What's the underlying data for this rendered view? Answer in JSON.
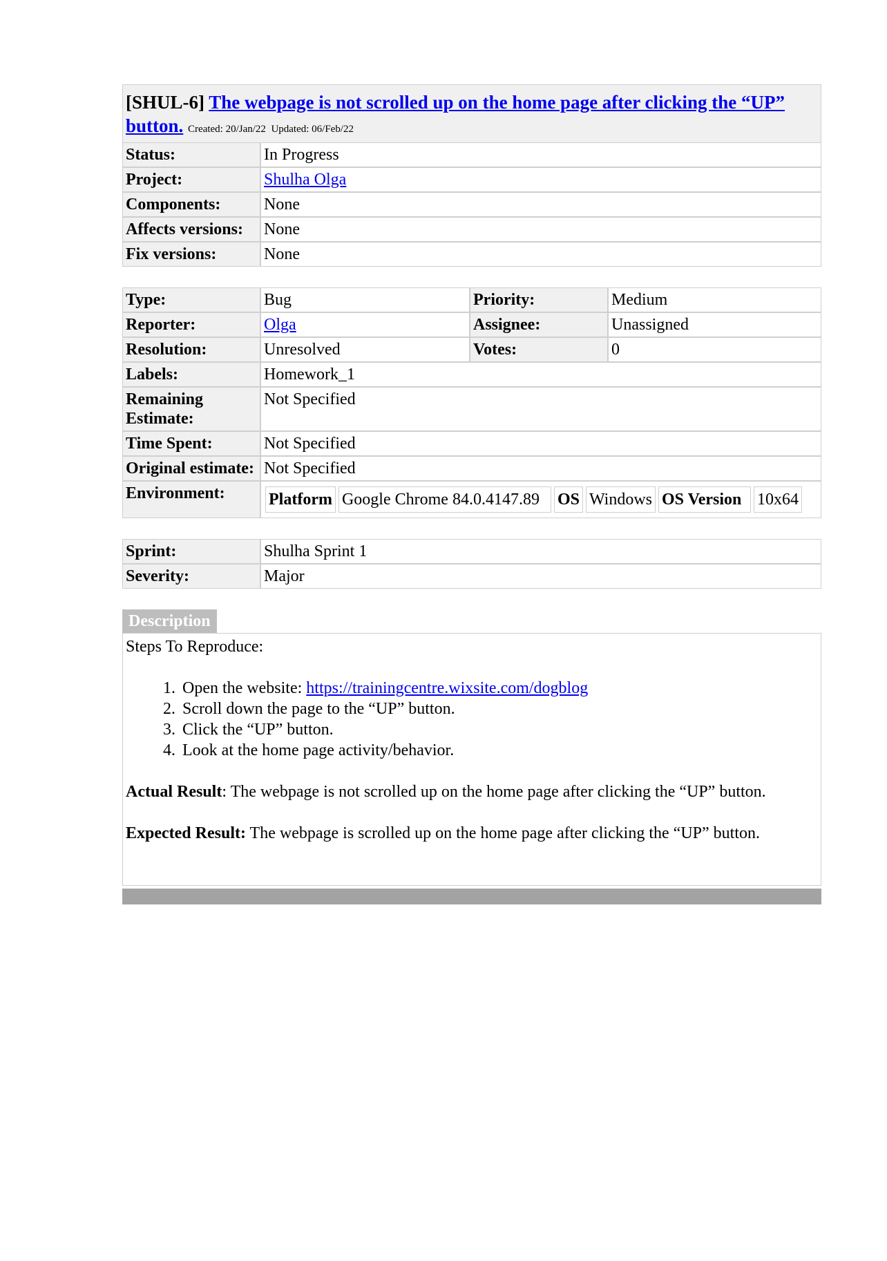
{
  "issue": {
    "key": "[SHUL-6]",
    "title": "The webpage is not scrolled up on the home page after clicking the “UP” button.",
    "created_label": "Created:",
    "created": "20/Jan/22",
    "updated_label": "Updated:",
    "updated": "06/Feb/22"
  },
  "summary": [
    {
      "label": "Status:",
      "value": "In Progress",
      "link": false
    },
    {
      "label": "Project:",
      "value": "Shulha Olga",
      "link": true
    },
    {
      "label": "Components:",
      "value": "None",
      "link": false
    },
    {
      "label": "Affects versions:",
      "value": "None",
      "link": false
    },
    {
      "label": "Fix versions:",
      "value": "None",
      "link": false
    }
  ],
  "details": {
    "type_label": "Type:",
    "type": "Bug",
    "priority_label": "Priority:",
    "priority": "Medium",
    "reporter_label": "Reporter:",
    "reporter": "Olga",
    "assignee_label": "Assignee:",
    "assignee": "Unassigned",
    "resolution_label": "Resolution:",
    "resolution": "Unresolved",
    "votes_label": "Votes:",
    "votes": "0",
    "labels_label": "Labels:",
    "labels": "Homework_1",
    "remaining_label": "Remaining Estimate:",
    "remaining": "Not Specified",
    "time_spent_label": "Time Spent:",
    "time_spent": "Not Specified",
    "original_label": "Original estimate:",
    "original": "Not Specified",
    "environment_label": "Environment:"
  },
  "environment": {
    "platform_label": "Platform",
    "platform": "Google Chrome 84.0.4147.89",
    "os_label": "OS",
    "os": "Windows",
    "os_version_label": "OS Version",
    "os_version": "10x64"
  },
  "extra": [
    {
      "label": "Sprint:",
      "value": "Shulha Sprint 1"
    },
    {
      "label": "Severity:",
      "value": "Major"
    }
  ],
  "description": {
    "tab": "Description",
    "intro": "Steps To Reproduce:",
    "step1_text": "Open the website: ",
    "step1_link": "https://trainingcentre.wixsite.com/dogblog",
    "step2": "Scroll down the page to the “UP” button.",
    "step3": "Click the “UP” button.",
    "step4": "Look at the home page activity/behavior.",
    "actual_label": "Actual Result",
    "actual_text": ": The webpage is not scrolled up on the home page after clicking the “UP” button.",
    "expected_label": "Expected Result:",
    "expected_text": " The webpage is scrolled up on the home page after clicking the “UP” button."
  }
}
